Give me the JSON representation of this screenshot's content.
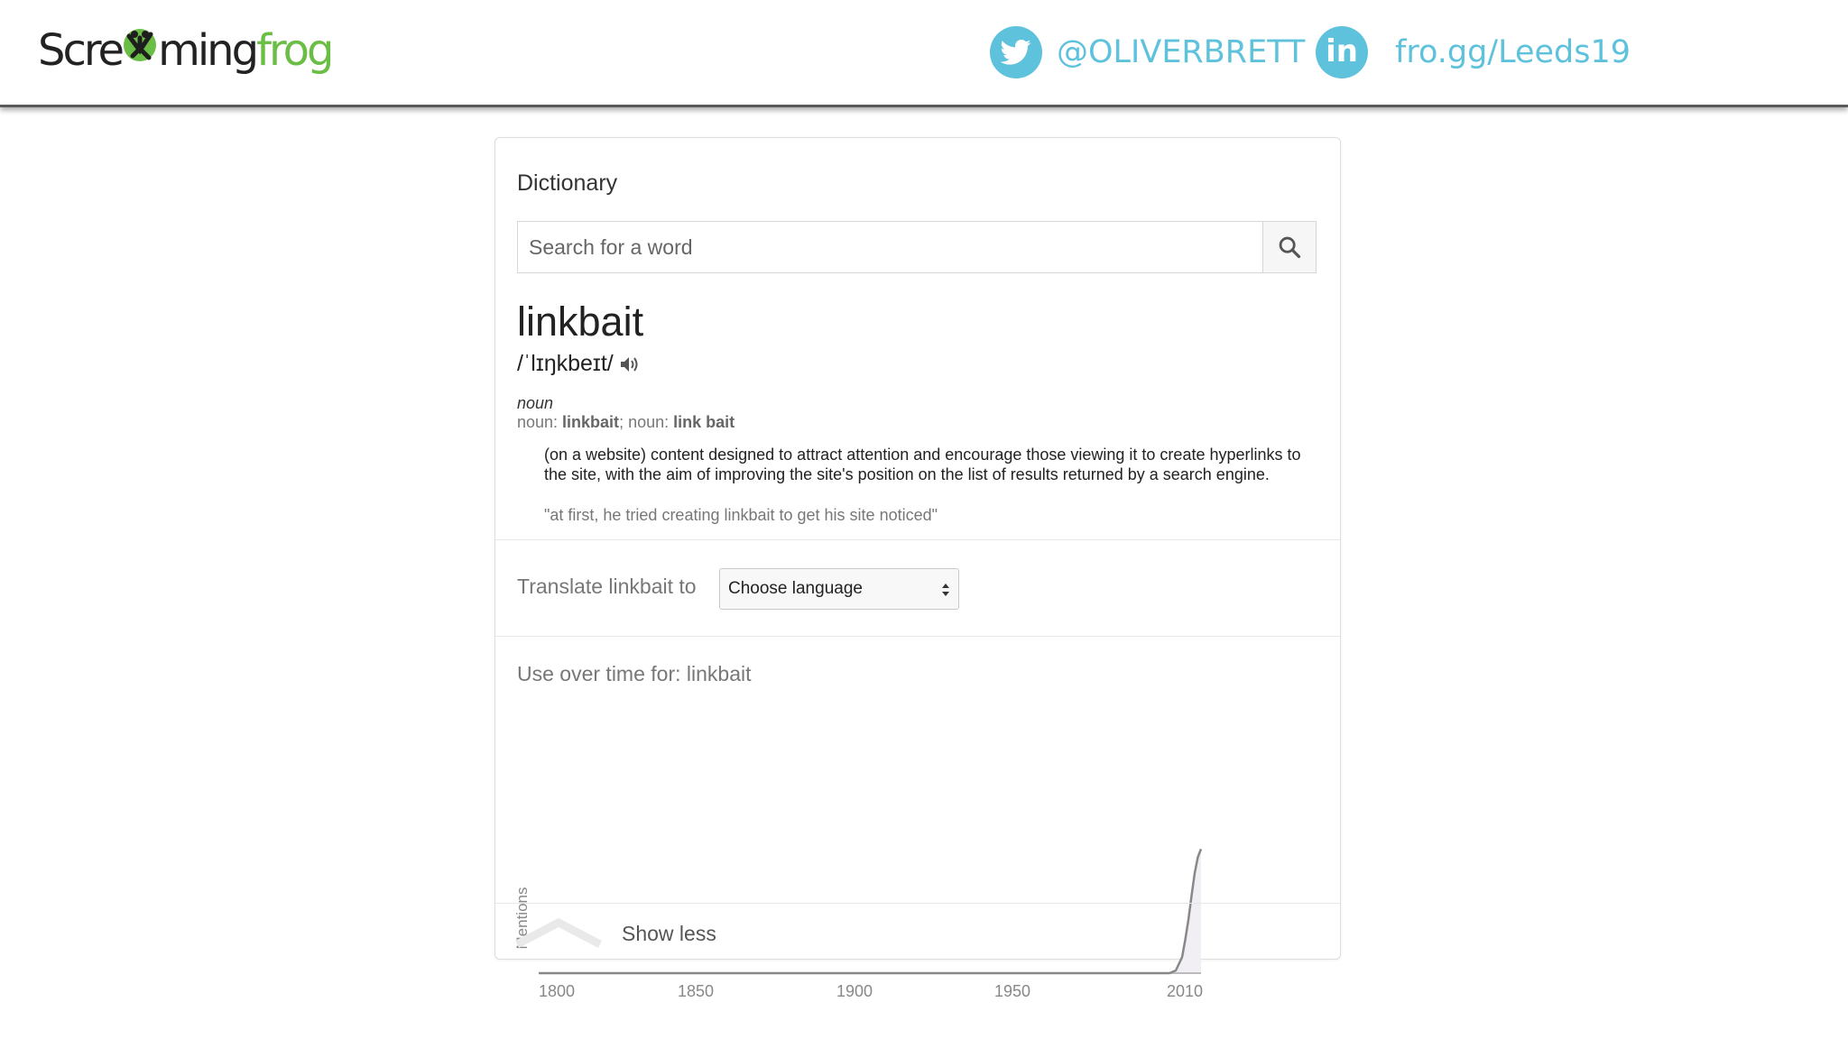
{
  "header": {
    "logo_parts": {
      "a": "Scre",
      "b": "ming",
      "c": "frog"
    },
    "logo_text": "Screamingfrog",
    "twitter_icon": "twitter-bird-icon",
    "twitter_handle": "@OLIVERBRETT",
    "linkedin_icon": "linkedin-icon",
    "linkedin_label": "in",
    "short_link": "fro.gg/Leeds19",
    "accent_color": "#5ec2dd",
    "logo_green": "#6abd45"
  },
  "dictionary": {
    "title": "Dictionary",
    "search_placeholder": "Search for a word",
    "search_icon": "search-icon",
    "word": "linkbait",
    "phonetic": "/ˈlɪŋkbeɪt/",
    "speaker_icon": "speaker-icon",
    "part_of_speech": "noun",
    "forms_prefix1": "noun: ",
    "form1": "linkbait",
    "forms_sep": "; noun: ",
    "form2": "link bait",
    "definition": "(on a website) content designed to attract attention and encourage those viewing it to create hyperlinks to the site, with the aim of improving the site's position on the list of results returned by a search engine.",
    "example": "\"at first, he tried creating linkbait to get his site noticed\""
  },
  "translate": {
    "label": "Translate linkbait to",
    "select_value": "Choose language"
  },
  "usage": {
    "title": "Use over time for: linkbait",
    "show_less": "Show less"
  },
  "chart_data": {
    "type": "line",
    "title": "",
    "xlabel": "",
    "ylabel": "Mentions",
    "x_ticks": [
      "1800",
      "1850",
      "1900",
      "1950",
      "2010"
    ],
    "xlim": [
      1800,
      2010
    ],
    "ylim": [
      0,
      100
    ],
    "grid": false,
    "series": [
      {
        "x": [
          1800,
          1850,
          1900,
          1950,
          1995,
          2000,
          2002,
          2004,
          2005,
          2006,
          2007,
          2008,
          2009,
          2010
        ],
        "values": [
          0,
          0,
          0,
          0,
          0,
          0,
          2,
          12,
          25,
          40,
          58,
          75,
          87,
          93
        ]
      }
    ],
    "line_color": "#888888",
    "fill_color": "#f1eff4"
  }
}
